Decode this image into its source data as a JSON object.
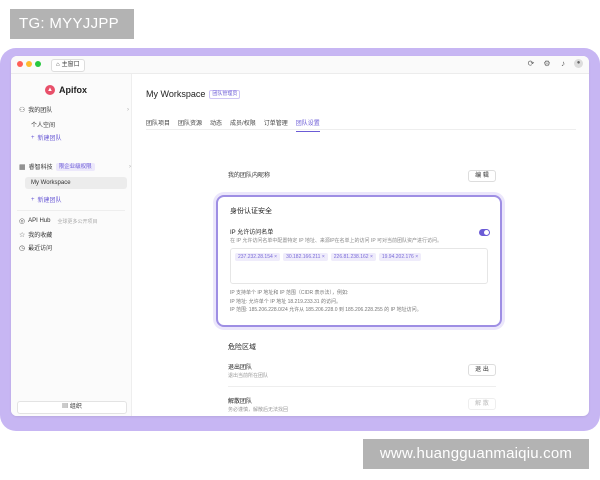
{
  "overlay": {
    "top_label": "TG: MYYJJPP",
    "bottom_label": "www.huangguanmaiqiu.com"
  },
  "titlebar": {
    "home_tab": "主窗口"
  },
  "sidebar": {
    "brand": "Apifox",
    "my_team": "我的团队",
    "personal_space": "个人空间",
    "new_team_1": "新建团队",
    "team_name": "睿智科技",
    "enterprise_badge": "限企业级权限",
    "my_workspace": "My Workspace",
    "new_team_2": "新建团队",
    "api_hub": "API Hub",
    "api_hub_desc": "全球更多公开项目",
    "favorites": "我的收藏",
    "recent": "最近访问",
    "org_button": "组织"
  },
  "main": {
    "workspace_title": "My Workspace",
    "workspace_tag": "团队管理员",
    "tabs": [
      "团队项目",
      "团队资源",
      "动态",
      "成员/权限",
      "订单管理",
      "团队设置"
    ],
    "active_tab": 5,
    "nickname_label": "我的团队内昵称",
    "edit_button": "编 辑",
    "security": {
      "title": "身份认证安全",
      "ip_whitelist_label": "IP 允许访问名单",
      "ip_whitelist_desc": "在 IP 允许访问名单中配置特定 IP 地址、来源IP在名单上的访问 IP 可对当前团队资产进行访问。",
      "ips": [
        "237.232.28.154",
        "30.182.166.211",
        "226.81.238.162",
        "19.94.202.176"
      ],
      "note_1": "IP 支持单个 IP 地址和 IP 范围（CIDR 表示法），例如:",
      "note_2": "IP 地址: 允许单个 IP 地址 18.219.233.31 的访问。",
      "note_3": "IP 范围: 185.206.228.0/24 允许从 185.206.228.0 到 185.206.228.255 的 IP 地址访问。"
    },
    "danger": {
      "title": "危险区域",
      "leave_label": "退出团队",
      "leave_desc": "退出当前所在团队",
      "leave_button": "退 出",
      "dissolve_label": "解散团队",
      "dissolve_desc": "务必谨慎，解散后无法找回",
      "dissolve_button": "解 散"
    }
  },
  "colors": {
    "accent": "#6b5bd6",
    "frame": "#c7b6f3",
    "card_border": "#9e8ee4"
  }
}
